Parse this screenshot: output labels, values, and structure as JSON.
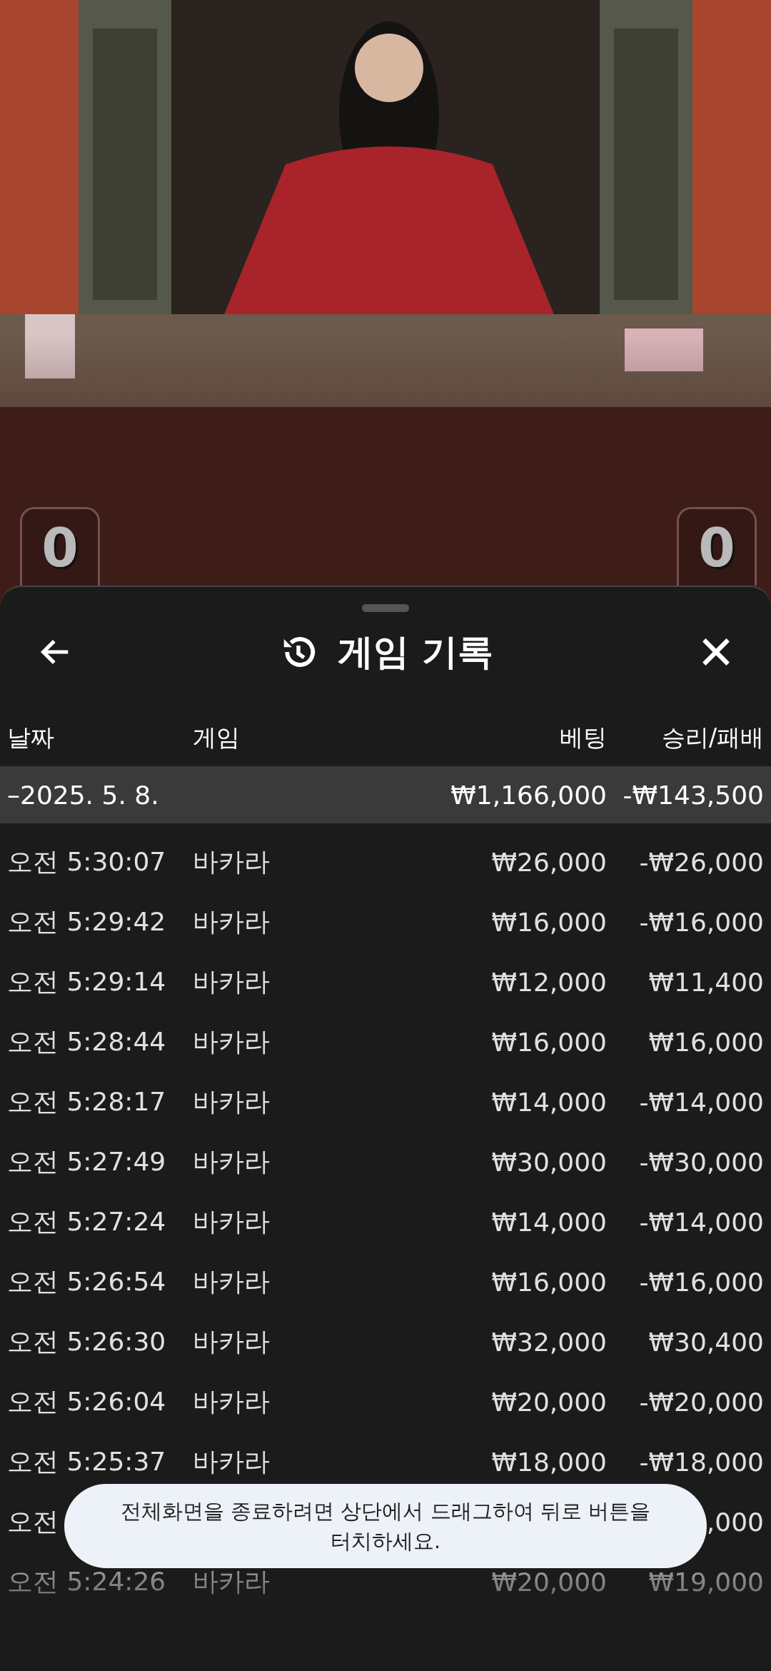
{
  "score_badges": [
    "0",
    "0"
  ],
  "sheet": {
    "title": "게임 기록"
  },
  "columns": [
    "날짜",
    "게임",
    "베팅",
    "승리/패배"
  ],
  "date_group": {
    "date": "–2025. 5. 8.",
    "bet": "₩1,166,000",
    "result": "-₩143,500"
  },
  "rows": [
    {
      "time": "오전 5:30:07",
      "game": "바카라",
      "bet": "₩26,000",
      "result": "-₩26,000"
    },
    {
      "time": "오전 5:29:42",
      "game": "바카라",
      "bet": "₩16,000",
      "result": "-₩16,000"
    },
    {
      "time": "오전 5:29:14",
      "game": "바카라",
      "bet": "₩12,000",
      "result": "₩11,400"
    },
    {
      "time": "오전 5:28:44",
      "game": "바카라",
      "bet": "₩16,000",
      "result": "₩16,000"
    },
    {
      "time": "오전 5:28:17",
      "game": "바카라",
      "bet": "₩14,000",
      "result": "-₩14,000"
    },
    {
      "time": "오전 5:27:49",
      "game": "바카라",
      "bet": "₩30,000",
      "result": "-₩30,000"
    },
    {
      "time": "오전 5:27:24",
      "game": "바카라",
      "bet": "₩14,000",
      "result": "-₩14,000"
    },
    {
      "time": "오전 5:26:54",
      "game": "바카라",
      "bet": "₩16,000",
      "result": "-₩16,000"
    },
    {
      "time": "오전 5:26:30",
      "game": "바카라",
      "bet": "₩32,000",
      "result": "₩30,400"
    },
    {
      "time": "오전 5:26:04",
      "game": "바카라",
      "bet": "₩20,000",
      "result": "-₩20,000"
    },
    {
      "time": "오전 5:25:37",
      "game": "바카라",
      "bet": "₩18,000",
      "result": "-₩18,000"
    },
    {
      "time": "오전",
      "result": ",000"
    },
    {
      "time": "오전 5:24:26",
      "game": "바카라",
      "bet": "₩20,000",
      "result": "₩19,000"
    }
  ],
  "toast": "전체화면을 종료하려면 상단에서 드래그하여 뒤로 버튼을 터치하세요."
}
